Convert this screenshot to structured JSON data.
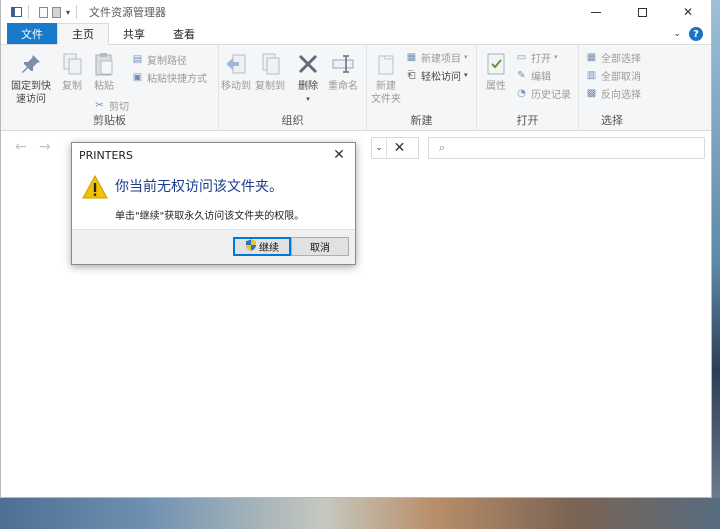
{
  "window": {
    "title": "文件资源管理器",
    "quick_access_dropdown": "▾"
  },
  "tabs": {
    "file": "文件",
    "home": "主页",
    "share": "共享",
    "view": "查看",
    "collapse": "⌄",
    "help": "?"
  },
  "ribbon": {
    "clipboard": {
      "label": "剪贴板",
      "pin_line1": "固定到快",
      "pin_line2": "速访问",
      "copy": "复制",
      "paste": "粘贴",
      "copy_path": "复制路径",
      "paste_shortcut": "粘贴快捷方式",
      "cut": "剪切"
    },
    "organize": {
      "label": "组织",
      "move_to": "移动到",
      "copy_to": "复制到",
      "delete": "删除",
      "rename": "重命名"
    },
    "new": {
      "label": "新建",
      "new_folder_line1": "新建",
      "new_folder_line2": "文件夹",
      "new_item": "新建项目",
      "easy_access": "轻松访问"
    },
    "open": {
      "label": "打开",
      "properties": "属性",
      "open": "打开",
      "edit": "编辑",
      "history": "历史记录"
    },
    "select": {
      "label": "选择",
      "select_all": "全部选择",
      "select_none": "全部取消",
      "invert": "反向选择"
    }
  },
  "nav": {
    "back": "←",
    "forward": "→",
    "address_dropdown": "⌄",
    "clear": "✕"
  },
  "dialog": {
    "title": "PRINTERS",
    "message": "你当前无权访问该文件夹。",
    "detail": "单击\"继续\"获取永久访问该文件夹的权限。",
    "continue": "继续",
    "cancel": "取消"
  },
  "colors": {
    "file_tab": "#1979ca",
    "dialog_message": "#1c3b8c",
    "warning": "#f2c400",
    "primary_button_border": "#0078d7"
  },
  "icons": {
    "close": "✕",
    "maximize": "square",
    "minimize": "line",
    "search": "⌕"
  }
}
